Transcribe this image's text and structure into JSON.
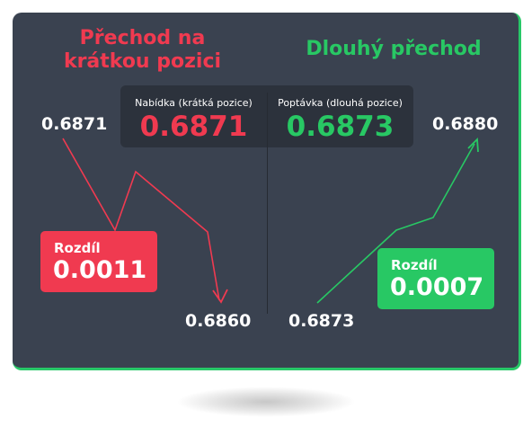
{
  "headings": {
    "short_transition": "Přechod na krátkou pozici",
    "long_transition": "Dlouhý přechod"
  },
  "quotes": {
    "bid_label": "Nabídka (krátká pozice)",
    "bid_value": "0.6871",
    "ask_label": "Poptávka (dlouhá pozice)",
    "ask_value": "0.6873"
  },
  "prices": {
    "short_start": "0.6871",
    "long_end": "0.6880",
    "short_end": "0.6860",
    "long_start": "0.6873"
  },
  "spreads": {
    "short": {
      "label": "Rozdíl",
      "value": "0.0011"
    },
    "long": {
      "label": "Rozdíl",
      "value": "0.0007"
    }
  },
  "colors": {
    "background": "#3a4250",
    "short": "#f03a50",
    "long": "#28c864",
    "quote_panel": "#2c323c"
  }
}
